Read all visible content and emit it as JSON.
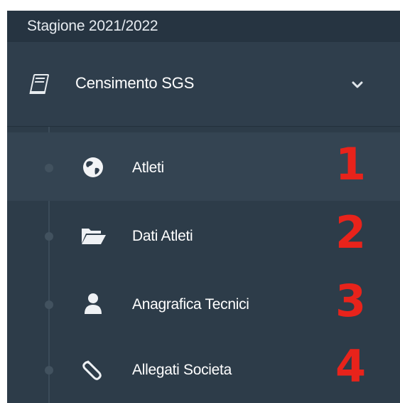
{
  "season": {
    "label": "Stagione 2021/2022"
  },
  "section": {
    "label": "Censimento SGS",
    "icon": "book-icon",
    "toggle_icon": "chevron-down-icon"
  },
  "menu": {
    "items": [
      {
        "label": "Atleti",
        "icon": "globe-icon",
        "number": "1",
        "active": true
      },
      {
        "label": "Dati Atleti",
        "icon": "folder-open-icon",
        "number": "2",
        "active": false
      },
      {
        "label": "Anagrafica Tecnici",
        "icon": "user-icon",
        "number": "3",
        "active": false
      },
      {
        "label": "Allegati Societa",
        "icon": "paperclip-icon",
        "number": "4",
        "active": false
      }
    ]
  },
  "colors": {
    "sidebar_bg": "#2f3e4c",
    "active_bg": "#344452",
    "annotation_red": "#e8231b"
  }
}
